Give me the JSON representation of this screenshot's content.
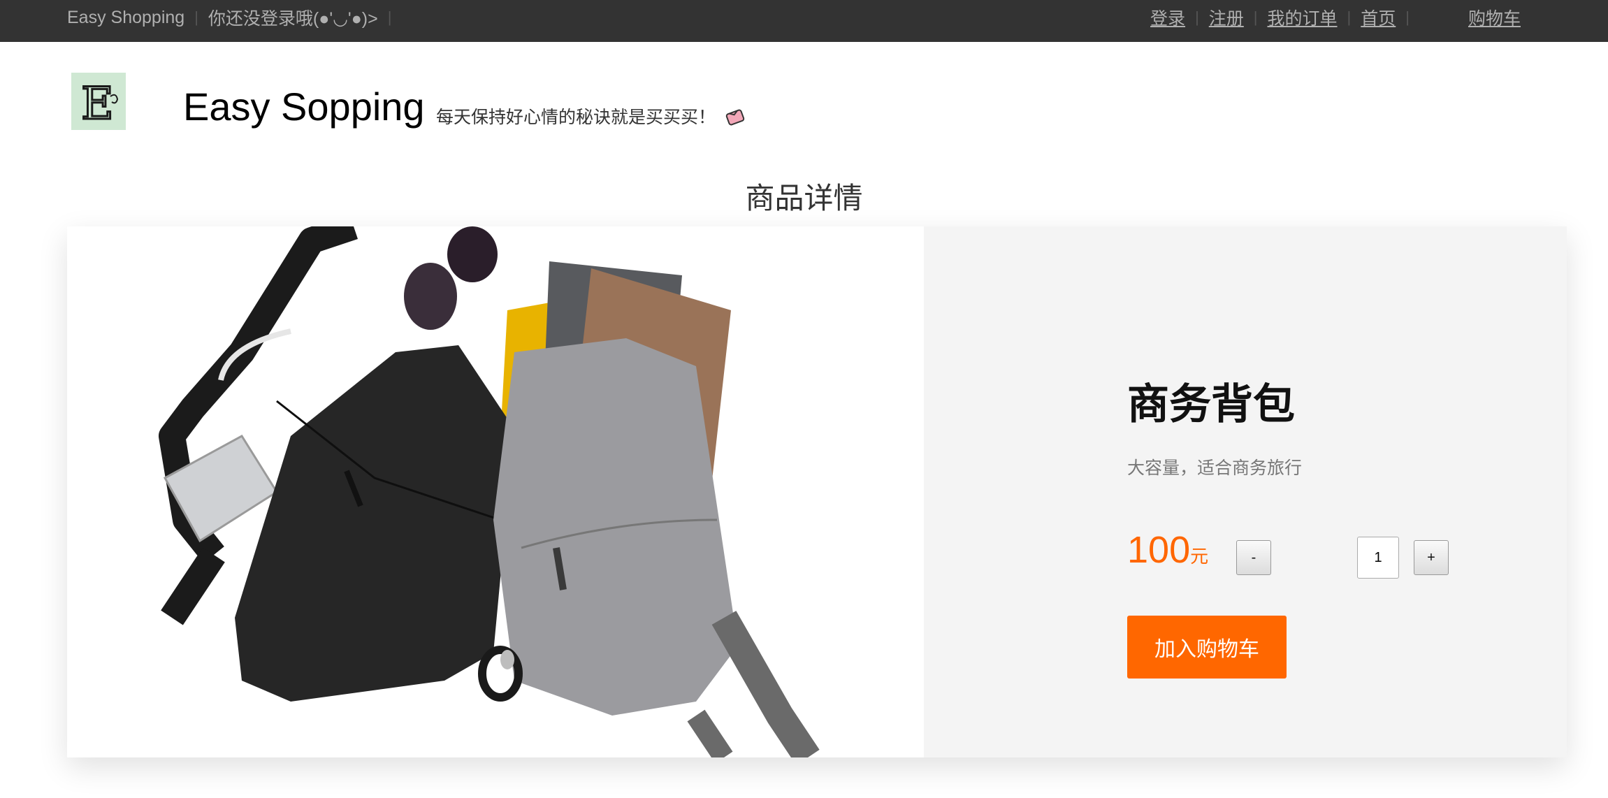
{
  "topbar": {
    "brand": "Easy Shopping",
    "status": "你还没登录哦(●'◡'●)>",
    "links": {
      "login": "登录",
      "register": "注册",
      "orders": "我的订单",
      "home": "首页",
      "cart": "购物车"
    }
  },
  "header": {
    "logo_letter": "E",
    "title": "Easy Sopping",
    "slogan": "每天保持好心情的秘诀就是买买买！"
  },
  "page": {
    "section_title": "商品详情"
  },
  "product": {
    "name": "商务背包",
    "description": "大容量，适合商务旅行",
    "price": "100",
    "price_unit": "元",
    "quantity": "1",
    "minus_label": "-",
    "plus_label": "+",
    "add_to_cart_label": "加入购物车"
  },
  "colors": {
    "topbar_bg": "#333333",
    "accent": "#ff6700",
    "price": "#ff6600",
    "card_bg": "#f4f4f4"
  },
  "icons": {
    "slogan_emoji": "gift-emoji-icon",
    "logo": "logo-icon"
  }
}
